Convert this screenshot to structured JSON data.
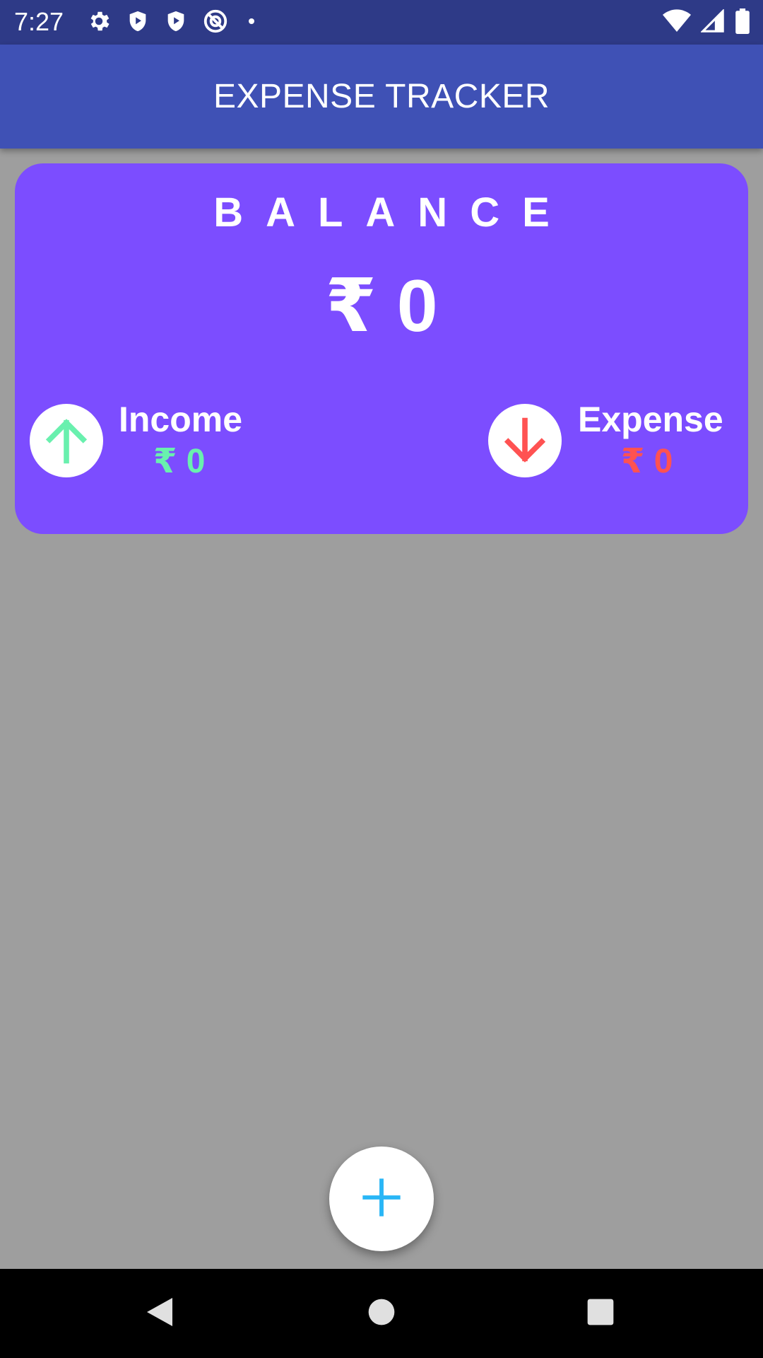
{
  "status_bar": {
    "time": "7:27",
    "left_icons": [
      "gear-icon",
      "shield-play-icon",
      "shield-play-icon",
      "no-sync-icon",
      "dot-icon"
    ],
    "right_icons": [
      "wifi-icon",
      "signal-icon",
      "battery-icon"
    ],
    "background": "#2e3a87"
  },
  "app_bar": {
    "title": "EXPENSE TRACKER",
    "background": "#3f51b5"
  },
  "balance_card": {
    "label": "BALANCE",
    "amount": "₹ 0",
    "background": "#7c4dff",
    "income": {
      "label": "Income",
      "amount": "₹ 0",
      "icon": "arrow-up-icon",
      "color": "#69f0ae"
    },
    "expense": {
      "label": "Expense",
      "amount": "₹ 0",
      "icon": "arrow-down-icon",
      "color": "#ff5252"
    }
  },
  "fab": {
    "icon": "plus-icon",
    "color": "#29b6f6"
  },
  "nav_bar": {
    "buttons": [
      "back-icon",
      "home-icon",
      "recents-icon"
    ]
  }
}
